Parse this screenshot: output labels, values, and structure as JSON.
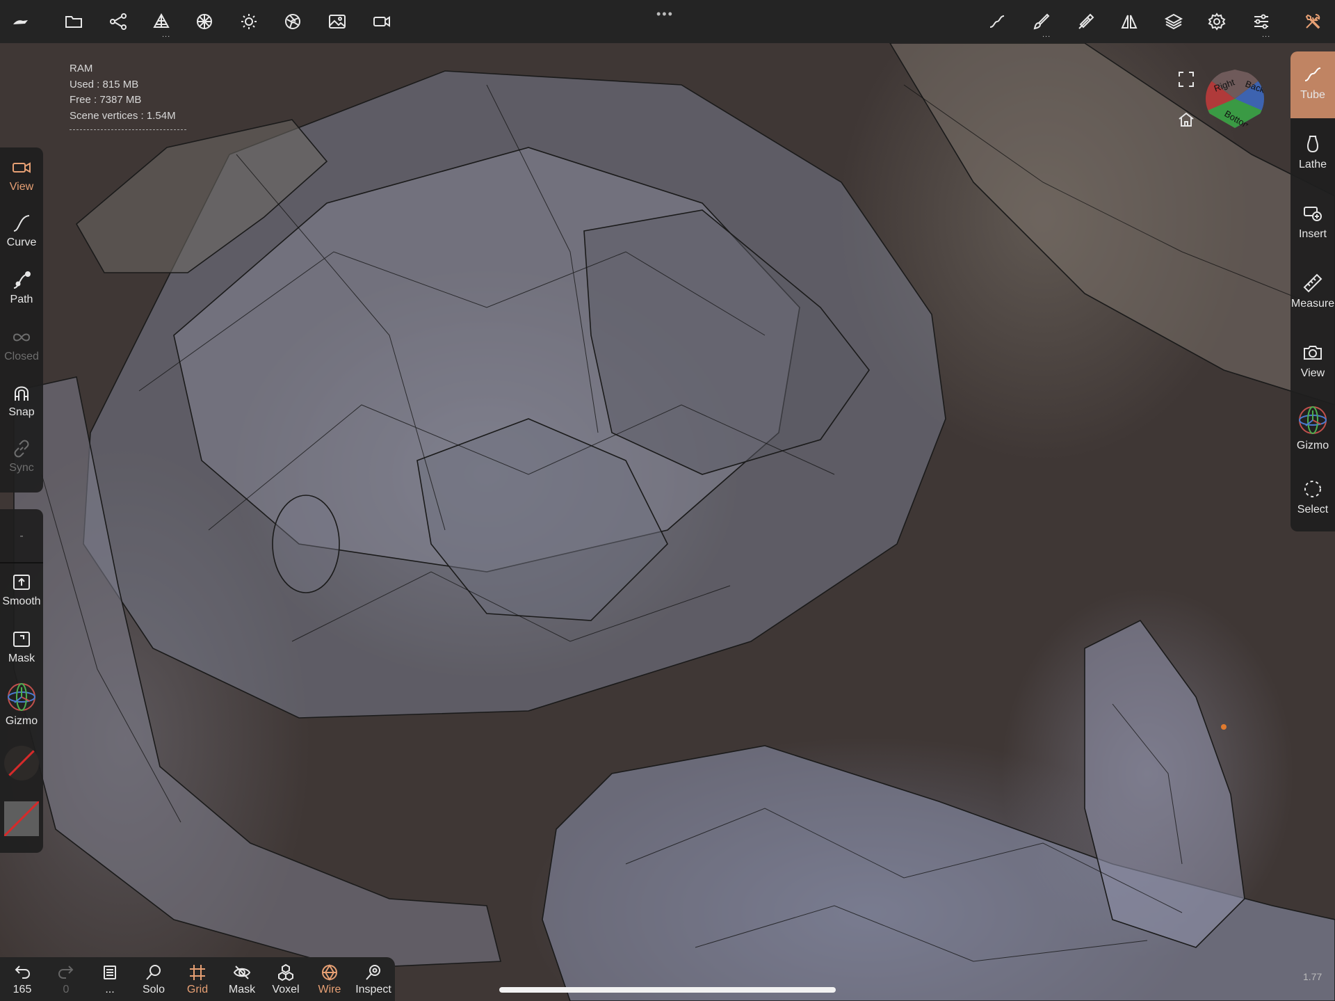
{
  "top_toolbar": {
    "left_icons": [
      "nomad-logo-icon",
      "folder-icon",
      "scene-graph-icon",
      "topology-icon",
      "material-icon",
      "lighting-icon",
      "camera-aperture-icon",
      "image-icon",
      "video-camera-icon"
    ],
    "center_menu": "•••",
    "right_icons": [
      "stroke-icon",
      "brush-icon",
      "eyedropper-icon",
      "symmetry-icon",
      "layers-icon",
      "settings-icon",
      "sliders-icon",
      "tools-icon"
    ],
    "sub_dots": "..."
  },
  "ram_info": {
    "title": "RAM",
    "used": "Used : 815 MB",
    "free": "Free : 7387 MB",
    "scene_vertices": "Scene vertices : 1.54M"
  },
  "left_panel_top": {
    "items": [
      {
        "label": "View",
        "icon": "video-camera-icon",
        "state": "active"
      },
      {
        "label": "Curve",
        "icon": "curve-icon",
        "state": "normal"
      },
      {
        "label": "Path",
        "icon": "path-icon",
        "state": "normal"
      },
      {
        "label": "Closed",
        "icon": "infinity-icon",
        "state": "disabled"
      },
      {
        "label": "Snap",
        "icon": "magnet-icon",
        "state": "normal"
      },
      {
        "label": "Sync",
        "icon": "link-icon",
        "state": "disabled"
      }
    ]
  },
  "left_panel_bottom": {
    "dash": "-",
    "items": [
      {
        "label": "Smooth",
        "icon": "smooth-icon"
      },
      {
        "label": "Mask",
        "icon": "mask-icon"
      },
      {
        "label": "Gizmo",
        "icon": "gizmo-icon"
      }
    ]
  },
  "right_panel": {
    "items": [
      {
        "label": "Tube",
        "icon": "tube-icon",
        "state": "active"
      },
      {
        "label": "Lathe",
        "icon": "lathe-icon",
        "state": "normal"
      },
      {
        "label": "Insert",
        "icon": "insert-icon",
        "state": "normal"
      },
      {
        "label": "Measure",
        "icon": "ruler-icon",
        "state": "normal"
      },
      {
        "label": "View",
        "icon": "camera-icon",
        "state": "normal"
      },
      {
        "label": "Gizmo",
        "icon": "gizmo-icon",
        "state": "normal"
      },
      {
        "label": "Select",
        "icon": "select-icon",
        "state": "normal"
      }
    ]
  },
  "view_cube": {
    "faces": [
      "Right",
      "Back",
      "Bottom"
    ],
    "colors": {
      "right": "#b03a3a",
      "back": "#3d63b0",
      "bottom": "#3a9a44"
    }
  },
  "bottom_toolbar": {
    "items": [
      {
        "label": "165",
        "icon": "undo-icon",
        "state": "normal"
      },
      {
        "label": "0",
        "icon": "redo-icon",
        "state": "dim"
      },
      {
        "label": "...",
        "icon": "history-icon",
        "state": "normal"
      },
      {
        "label": "Solo",
        "icon": "solo-icon",
        "state": "normal"
      },
      {
        "label": "Grid",
        "icon": "grid-icon",
        "state": "orange"
      },
      {
        "label": "Mask",
        "icon": "mask-hide-icon",
        "state": "normal"
      },
      {
        "label": "Voxel",
        "icon": "voxel-icon",
        "state": "normal"
      },
      {
        "label": "Wire",
        "icon": "wire-icon",
        "state": "orange"
      },
      {
        "label": "Inspect",
        "icon": "inspect-icon",
        "state": "normal"
      }
    ]
  },
  "zoom_value": "1.77",
  "colors": {
    "accent": "#e7a074",
    "panel": "#242424",
    "background": "#3f3735"
  }
}
